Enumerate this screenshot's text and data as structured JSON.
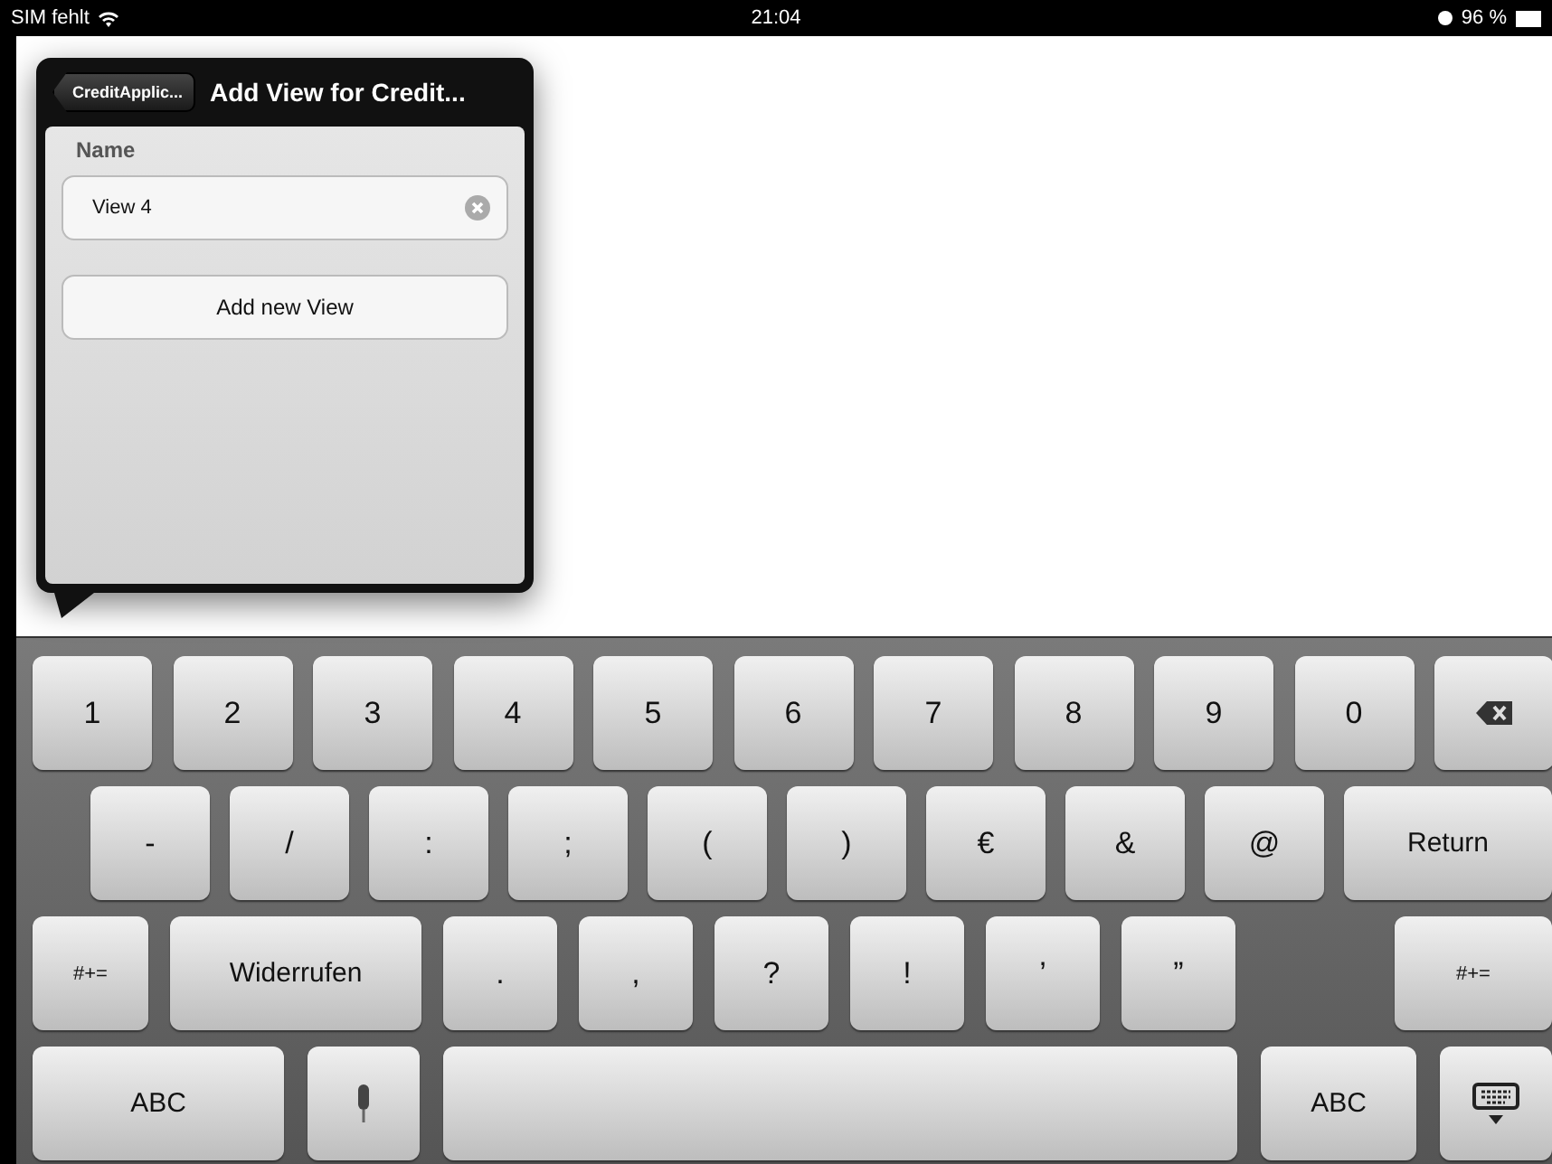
{
  "status_bar": {
    "carrier": "SIM fehlt",
    "time": "21:04",
    "battery": "96 %"
  },
  "popover": {
    "back_button": "CreditApplic...",
    "title": "Add View for Credit...",
    "section_label": "Name",
    "name_field": {
      "value": "View 4"
    },
    "button": "Add new View"
  },
  "keyboard": {
    "rows": [
      [
        {
          "kind": "key",
          "label": "1"
        },
        {
          "kind": "key",
          "label": "2"
        },
        {
          "kind": "key",
          "label": "3"
        },
        {
          "kind": "key",
          "label": "4"
        },
        {
          "kind": "key",
          "label": "5"
        },
        {
          "kind": "key",
          "label": "6"
        },
        {
          "kind": "key",
          "label": "7"
        },
        {
          "kind": "key",
          "label": "8"
        },
        {
          "kind": "key",
          "label": "9"
        },
        {
          "kind": "key",
          "label": "0"
        },
        {
          "kind": "backspace"
        }
      ],
      [
        {
          "kind": "key",
          "label": "-"
        },
        {
          "kind": "key",
          "label": "/"
        },
        {
          "kind": "key",
          "label": ":"
        },
        {
          "kind": "key",
          "label": ";"
        },
        {
          "kind": "key",
          "label": "("
        },
        {
          "kind": "key",
          "label": ")"
        },
        {
          "kind": "key",
          "label": "€"
        },
        {
          "kind": "key",
          "label": "&"
        },
        {
          "kind": "key",
          "label": "@"
        },
        {
          "kind": "return",
          "label": "Return"
        }
      ],
      [
        {
          "kind": "mod",
          "label": "#+="
        },
        {
          "kind": "wide",
          "label": "Widerrufen"
        },
        {
          "kind": "narrow",
          "label": "."
        },
        {
          "kind": "narrow",
          "label": ","
        },
        {
          "kind": "narrow",
          "label": "?"
        },
        {
          "kind": "narrow",
          "label": "!"
        },
        {
          "kind": "narrow",
          "label": "’"
        },
        {
          "kind": "narrow",
          "label": "”"
        },
        {
          "kind": "mod_right",
          "label": "#+="
        }
      ],
      [
        {
          "kind": "wide",
          "label": "ABC"
        },
        {
          "kind": "mic"
        },
        {
          "kind": "space"
        },
        {
          "kind": "abc_right",
          "label": "ABC"
        },
        {
          "kind": "hide"
        }
      ]
    ]
  }
}
